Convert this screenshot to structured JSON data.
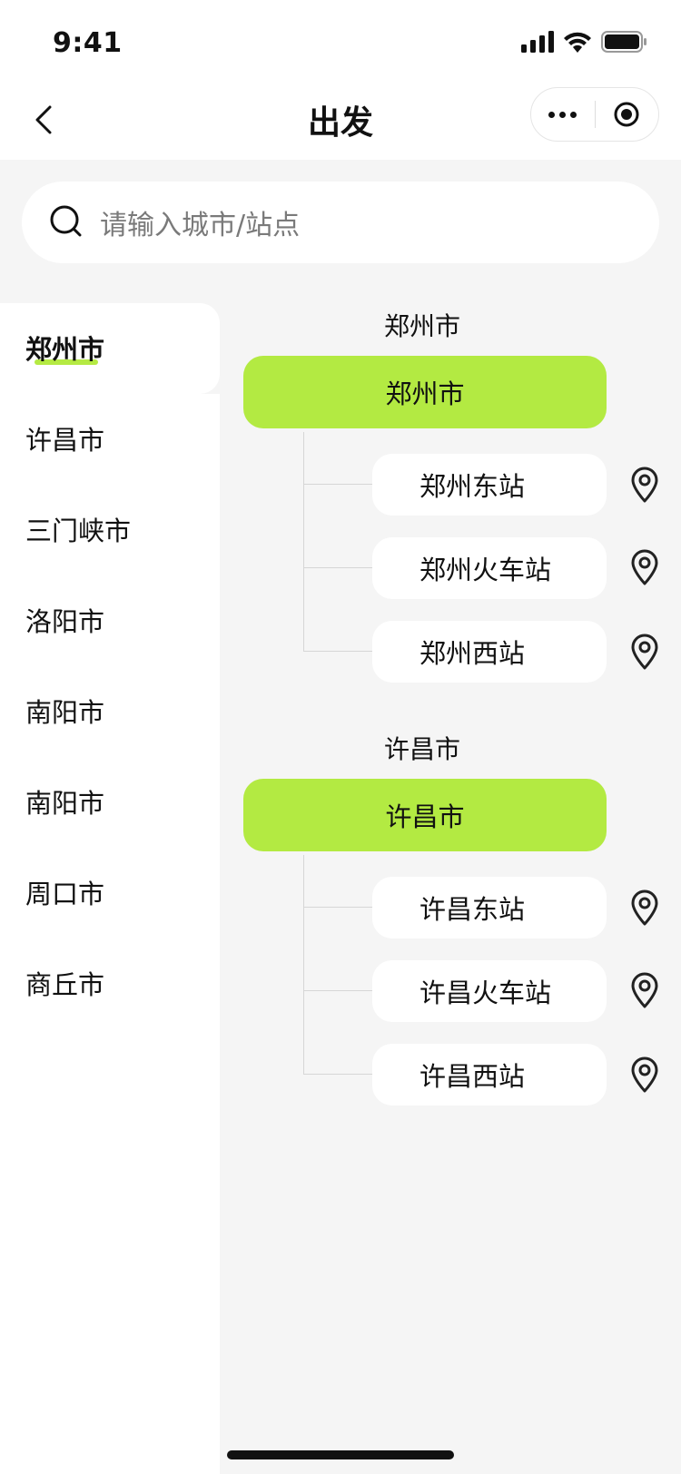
{
  "status_bar": {
    "time": "9:41"
  },
  "nav": {
    "title": "出发"
  },
  "search": {
    "placeholder": "请输入城市/站点"
  },
  "sidebar": {
    "items": [
      {
        "label": "郑州市",
        "active": true
      },
      {
        "label": "许昌市",
        "active": false
      },
      {
        "label": "三门峡市",
        "active": false
      },
      {
        "label": "洛阳市",
        "active": false
      },
      {
        "label": "南阳市",
        "active": false
      },
      {
        "label": "南阳市",
        "active": false
      },
      {
        "label": "周口市",
        "active": false
      },
      {
        "label": "商丘市",
        "active": false
      }
    ]
  },
  "sections": [
    {
      "title": "郑州市",
      "city_button": "郑州市",
      "stations": [
        "郑州东站",
        "郑州火车站",
        "郑州西站"
      ]
    },
    {
      "title": "许昌市",
      "city_button": "许昌市",
      "stations": [
        "许昌东站",
        "许昌火车站",
        "许昌西站"
      ]
    }
  ],
  "colors": {
    "accent": "#b3ea42",
    "background": "#f5f5f5"
  },
  "icons": {
    "back": "chevron-left-icon",
    "more": "more-dots-icon",
    "close": "record-circle-icon",
    "search": "search-icon",
    "location": "location-pin-icon"
  }
}
